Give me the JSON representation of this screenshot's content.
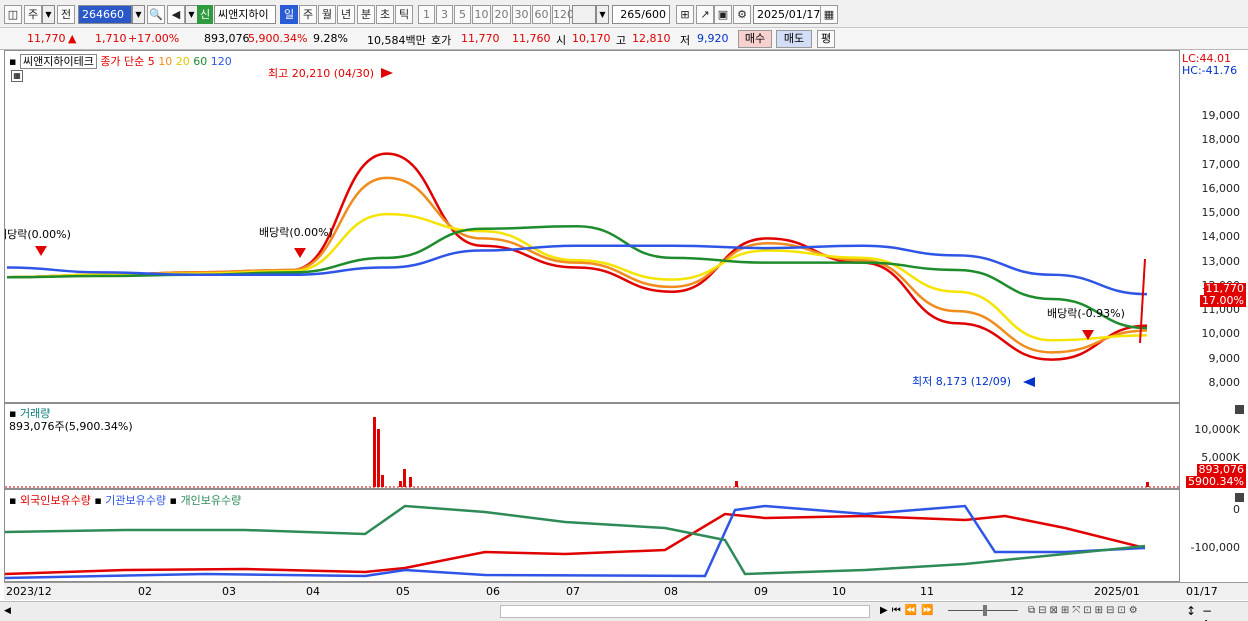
{
  "toolbar": {
    "period_week": "주",
    "period_prev": "전",
    "stock_code": "264660",
    "new_label": "신",
    "stock_name": "씨앤지하이",
    "periods": [
      "일",
      "주",
      "월",
      "년",
      "분",
      "초",
      "틱"
    ],
    "intervals": [
      "1",
      "3",
      "5",
      "10",
      "20",
      "30",
      "60",
      "120"
    ],
    "count": "265",
    "count_total": "/600",
    "date": "2025/01/17"
  },
  "quote": {
    "price": "11,770",
    "change": "1,710",
    "change_pct": "+17.00%",
    "volume": "893,076",
    "volume_pct": "5,900.34%",
    "turnover_pct": "9.28%",
    "amount": "10,584백만",
    "bid_label": "호가",
    "ask": "11,770",
    "bid": "11,760",
    "open_label": "시",
    "open": "10,170",
    "high_label": "고",
    "high": "12,810",
    "low_label": "저",
    "low": "9,920",
    "buy_label": "매수",
    "sell_label": "매도",
    "avg_label": "평"
  },
  "price_pane": {
    "name": "씨앤지하이테크",
    "indicator": "종가 단순",
    "ma_periods": [
      "5",
      "10",
      "20",
      "60",
      "120"
    ],
    "lc": "LC:44.01",
    "hc": "HC:-41.76",
    "high_annot": "최고 20,210 (04/30)",
    "low_annot": "최저 8,173 (12/09)",
    "div1": "배당락(0.00%)",
    "div2": "배당락(0.00%)",
    "div3": "배당락(-0.93%)",
    "current_price": "11,770",
    "current_pct": "17.00%",
    "yticks": [
      "19,000",
      "18,000",
      "17,000",
      "16,000",
      "15,000",
      "14,000",
      "13,000",
      "12,000",
      "11,000",
      "10,000",
      "9,000",
      "8,000"
    ]
  },
  "volume_pane": {
    "title": "거래량",
    "subtitle": "893,076주(5,900.34%)",
    "yticks": [
      "10,000K",
      "5,000K"
    ],
    "current": "893,076",
    "current_pct": "5900.34%"
  },
  "holding_pane": {
    "legend": [
      "외국인보유수량",
      "기관보유수량",
      "개인보유수량"
    ],
    "yticks": [
      "0",
      "-100,000"
    ]
  },
  "xaxis": [
    "2023/12",
    "02",
    "03",
    "04",
    "05",
    "06",
    "07",
    "08",
    "09",
    "10",
    "11",
    "12",
    "2025/01",
    "01/17"
  ],
  "colors": {
    "ma5": "#e00000",
    "ma10": "#f08c1e",
    "ma20": "#f5e300",
    "ma60": "#1e8c2c",
    "ma120": "#2e55e6",
    "foreign": "#e00000",
    "institution": "#2e55e6",
    "individual": "#2e8b57"
  },
  "chart_data": {
    "type": "line",
    "title": "씨앤지하이테크",
    "x": [
      "2023/12",
      "02",
      "03",
      "04",
      "05",
      "06",
      "07",
      "08",
      "09",
      "10",
      "11",
      "12",
      "2025/01"
    ],
    "ylim": [
      7500,
      20700
    ],
    "series": [
      {
        "name": "5",
        "values": [
          12400,
          12500,
          12600,
          12700,
          17500,
          13700,
          12800,
          11800,
          14000,
          13000,
          10500,
          9000,
          10400
        ]
      },
      {
        "name": "10",
        "values": [
          12400,
          12500,
          12600,
          12700,
          16500,
          14000,
          13000,
          12000,
          13800,
          13100,
          11000,
          9300,
          10200
        ]
      },
      {
        "name": "20",
        "values": [
          12400,
          12500,
          12550,
          12650,
          15000,
          14300,
          13100,
          12300,
          13500,
          13200,
          11800,
          9800,
          10000
        ]
      },
      {
        "name": "60",
        "values": [
          12400,
          12450,
          12500,
          12600,
          13200,
          14400,
          14500,
          13200,
          13000,
          13000,
          12700,
          11500,
          10300
        ]
      },
      {
        "name": "120",
        "values": [
          12800,
          12600,
          12500,
          12500,
          12800,
          13500,
          13700,
          13700,
          13600,
          13700,
          13300,
          12500,
          11700
        ]
      }
    ]
  }
}
